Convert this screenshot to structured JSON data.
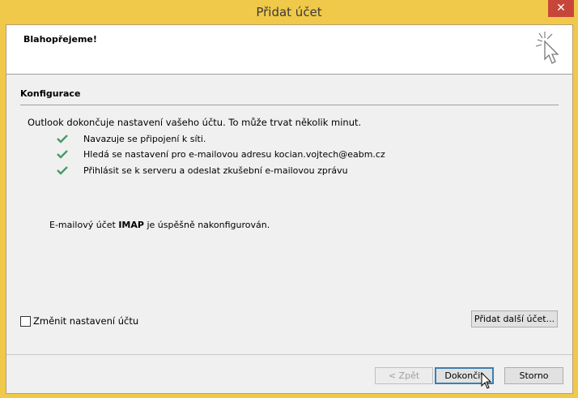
{
  "window": {
    "title": "Přidat účet",
    "close_glyph": "✕"
  },
  "header": {
    "title": "Blahopřejeme!",
    "icon": "sparkle-cursor-icon"
  },
  "section": {
    "title": "Konfigurace"
  },
  "intro": "Outlook dokončuje nastavení vašeho účtu. To může trvat několik minut.",
  "steps": [
    {
      "label": "Navazuje se připojení k síti.",
      "status": "done"
    },
    {
      "label": "Hledá se nastavení pro e-mailovou adresu kocian.vojtech@eabm.cz",
      "status": "done"
    },
    {
      "label": "Přihlásit se k serveru a odeslat zkušební e-mailovou zprávu",
      "status": "done"
    }
  ],
  "result": {
    "prefix": "E-mailový účet ",
    "protocol": "IMAP",
    "suffix": " je úspěšně nakonfigurován."
  },
  "change_settings": {
    "label": "Změnit nastavení účtu",
    "checked": false
  },
  "buttons": {
    "add_another": "Přidat další účet...",
    "back": "< Zpět",
    "finish": "Dokončit",
    "cancel": "Storno"
  },
  "colors": {
    "titlebar": "#f0c94a",
    "close": "#c7463a",
    "check": "#4a9a6a"
  }
}
